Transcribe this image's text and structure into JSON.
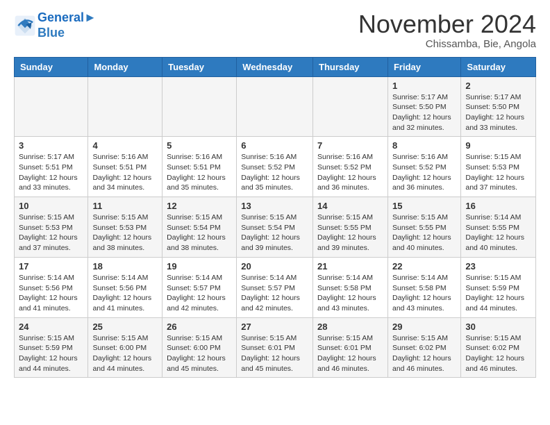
{
  "header": {
    "logo_line1": "General",
    "logo_line2": "Blue",
    "month_title": "November 2024",
    "location": "Chissamba, Bie, Angola"
  },
  "weekdays": [
    "Sunday",
    "Monday",
    "Tuesday",
    "Wednesday",
    "Thursday",
    "Friday",
    "Saturday"
  ],
  "weeks": [
    [
      {
        "day": "",
        "info": ""
      },
      {
        "day": "",
        "info": ""
      },
      {
        "day": "",
        "info": ""
      },
      {
        "day": "",
        "info": ""
      },
      {
        "day": "",
        "info": ""
      },
      {
        "day": "1",
        "info": "Sunrise: 5:17 AM\nSunset: 5:50 PM\nDaylight: 12 hours\nand 32 minutes."
      },
      {
        "day": "2",
        "info": "Sunrise: 5:17 AM\nSunset: 5:50 PM\nDaylight: 12 hours\nand 33 minutes."
      }
    ],
    [
      {
        "day": "3",
        "info": "Sunrise: 5:17 AM\nSunset: 5:51 PM\nDaylight: 12 hours\nand 33 minutes."
      },
      {
        "day": "4",
        "info": "Sunrise: 5:16 AM\nSunset: 5:51 PM\nDaylight: 12 hours\nand 34 minutes."
      },
      {
        "day": "5",
        "info": "Sunrise: 5:16 AM\nSunset: 5:51 PM\nDaylight: 12 hours\nand 35 minutes."
      },
      {
        "day": "6",
        "info": "Sunrise: 5:16 AM\nSunset: 5:52 PM\nDaylight: 12 hours\nand 35 minutes."
      },
      {
        "day": "7",
        "info": "Sunrise: 5:16 AM\nSunset: 5:52 PM\nDaylight: 12 hours\nand 36 minutes."
      },
      {
        "day": "8",
        "info": "Sunrise: 5:16 AM\nSunset: 5:52 PM\nDaylight: 12 hours\nand 36 minutes."
      },
      {
        "day": "9",
        "info": "Sunrise: 5:15 AM\nSunset: 5:53 PM\nDaylight: 12 hours\nand 37 minutes."
      }
    ],
    [
      {
        "day": "10",
        "info": "Sunrise: 5:15 AM\nSunset: 5:53 PM\nDaylight: 12 hours\nand 37 minutes."
      },
      {
        "day": "11",
        "info": "Sunrise: 5:15 AM\nSunset: 5:53 PM\nDaylight: 12 hours\nand 38 minutes."
      },
      {
        "day": "12",
        "info": "Sunrise: 5:15 AM\nSunset: 5:54 PM\nDaylight: 12 hours\nand 38 minutes."
      },
      {
        "day": "13",
        "info": "Sunrise: 5:15 AM\nSunset: 5:54 PM\nDaylight: 12 hours\nand 39 minutes."
      },
      {
        "day": "14",
        "info": "Sunrise: 5:15 AM\nSunset: 5:55 PM\nDaylight: 12 hours\nand 39 minutes."
      },
      {
        "day": "15",
        "info": "Sunrise: 5:15 AM\nSunset: 5:55 PM\nDaylight: 12 hours\nand 40 minutes."
      },
      {
        "day": "16",
        "info": "Sunrise: 5:14 AM\nSunset: 5:55 PM\nDaylight: 12 hours\nand 40 minutes."
      }
    ],
    [
      {
        "day": "17",
        "info": "Sunrise: 5:14 AM\nSunset: 5:56 PM\nDaylight: 12 hours\nand 41 minutes."
      },
      {
        "day": "18",
        "info": "Sunrise: 5:14 AM\nSunset: 5:56 PM\nDaylight: 12 hours\nand 41 minutes."
      },
      {
        "day": "19",
        "info": "Sunrise: 5:14 AM\nSunset: 5:57 PM\nDaylight: 12 hours\nand 42 minutes."
      },
      {
        "day": "20",
        "info": "Sunrise: 5:14 AM\nSunset: 5:57 PM\nDaylight: 12 hours\nand 42 minutes."
      },
      {
        "day": "21",
        "info": "Sunrise: 5:14 AM\nSunset: 5:58 PM\nDaylight: 12 hours\nand 43 minutes."
      },
      {
        "day": "22",
        "info": "Sunrise: 5:14 AM\nSunset: 5:58 PM\nDaylight: 12 hours\nand 43 minutes."
      },
      {
        "day": "23",
        "info": "Sunrise: 5:15 AM\nSunset: 5:59 PM\nDaylight: 12 hours\nand 44 minutes."
      }
    ],
    [
      {
        "day": "24",
        "info": "Sunrise: 5:15 AM\nSunset: 5:59 PM\nDaylight: 12 hours\nand 44 minutes."
      },
      {
        "day": "25",
        "info": "Sunrise: 5:15 AM\nSunset: 6:00 PM\nDaylight: 12 hours\nand 44 minutes."
      },
      {
        "day": "26",
        "info": "Sunrise: 5:15 AM\nSunset: 6:00 PM\nDaylight: 12 hours\nand 45 minutes."
      },
      {
        "day": "27",
        "info": "Sunrise: 5:15 AM\nSunset: 6:01 PM\nDaylight: 12 hours\nand 45 minutes."
      },
      {
        "day": "28",
        "info": "Sunrise: 5:15 AM\nSunset: 6:01 PM\nDaylight: 12 hours\nand 46 minutes."
      },
      {
        "day": "29",
        "info": "Sunrise: 5:15 AM\nSunset: 6:02 PM\nDaylight: 12 hours\nand 46 minutes."
      },
      {
        "day": "30",
        "info": "Sunrise: 5:15 AM\nSunset: 6:02 PM\nDaylight: 12 hours\nand 46 minutes."
      }
    ]
  ]
}
